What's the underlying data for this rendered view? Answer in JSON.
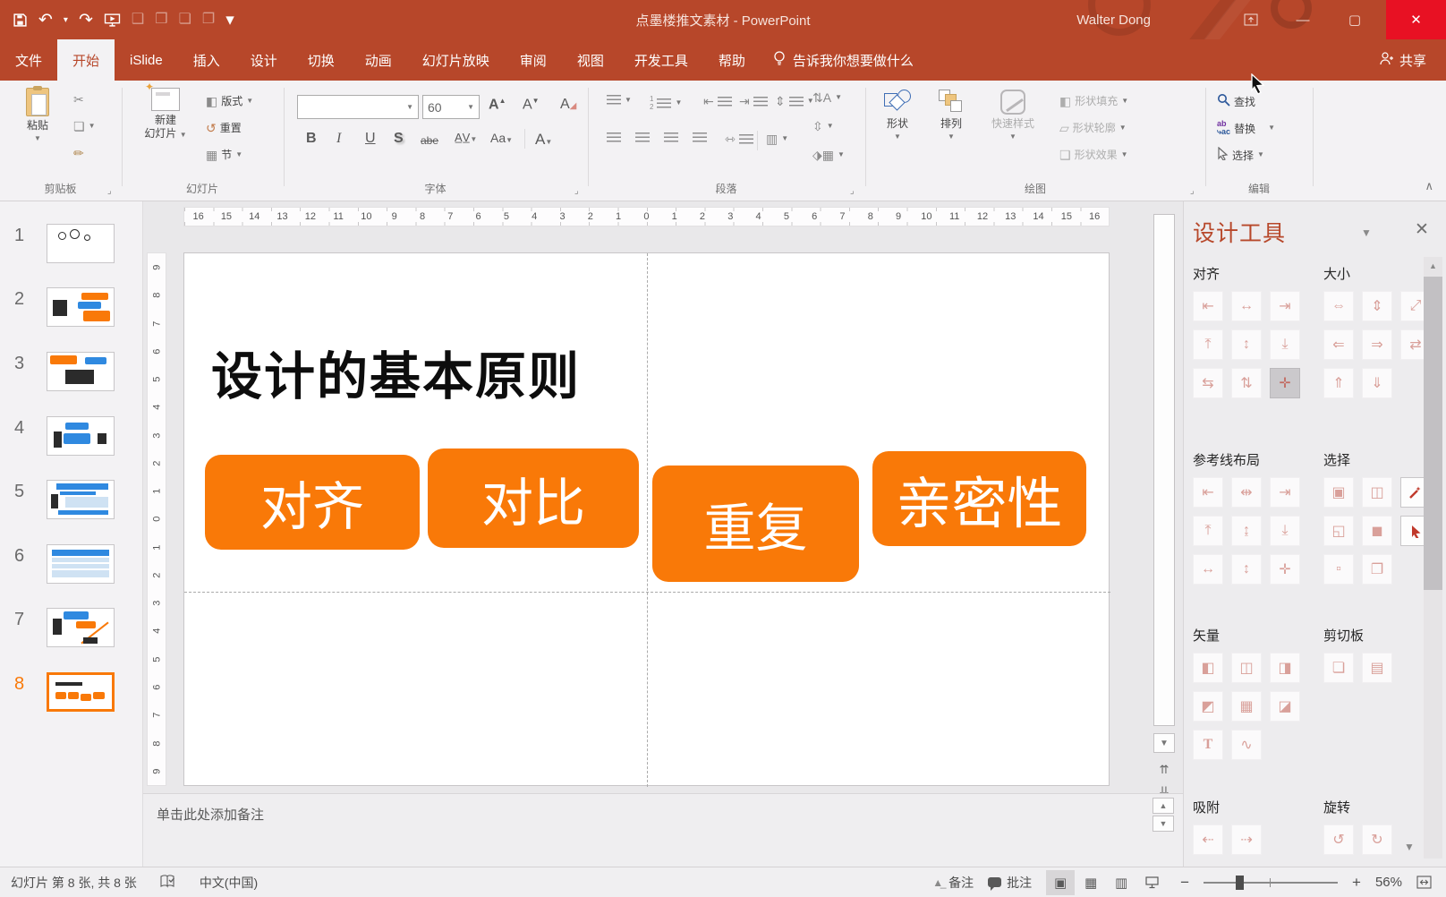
{
  "titlebar": {
    "title": "点墨楼推文素材  -  PowerPoint",
    "user": "Walter Dong",
    "qat": [
      {
        "name": "save"
      },
      {
        "name": "undo",
        "caret": true
      },
      {
        "name": "redo"
      },
      {
        "name": "slideshow-from-start"
      },
      {
        "name": "frame-tool",
        "disabled": true
      },
      {
        "name": "crop-tool",
        "disabled": true
      },
      {
        "name": "group-tool",
        "disabled": true
      },
      {
        "name": "ungroup-tool",
        "disabled": true
      },
      {
        "name": "customize-qat"
      }
    ]
  },
  "tabs": [
    {
      "label": "文件"
    },
    {
      "label": "开始",
      "active": true
    },
    {
      "label": "iSlide"
    },
    {
      "label": "插入"
    },
    {
      "label": "设计"
    },
    {
      "label": "切换"
    },
    {
      "label": "动画"
    },
    {
      "label": "幻灯片放映"
    },
    {
      "label": "审阅"
    },
    {
      "label": "视图"
    },
    {
      "label": "开发工具"
    },
    {
      "label": "帮助"
    }
  ],
  "tellme": "告诉我你想要做什么",
  "share": "共享",
  "ribbon": {
    "clipboard": {
      "paste": "粘贴",
      "group": "剪贴板"
    },
    "slides": {
      "new_slide_line1": "新建",
      "new_slide_line2": "幻灯片",
      "layout": "版式",
      "reset": "重置",
      "section": "节",
      "group": "幻灯片"
    },
    "font": {
      "size": "60",
      "group": "字体"
    },
    "paragraph": {
      "group": "段落"
    },
    "drawing": {
      "shapes": "形状",
      "arrange": "排列",
      "quick_styles": "快速样式",
      "shape_fill": "形状填充",
      "shape_outline": "形状轮廓",
      "shape_effects": "形状效果",
      "group": "绘图"
    },
    "editing": {
      "find": "查找",
      "replace": "替换",
      "select": "选择",
      "group": "编辑"
    }
  },
  "thumbnails": [
    {
      "num": "1"
    },
    {
      "num": "2"
    },
    {
      "num": "3"
    },
    {
      "num": "4"
    },
    {
      "num": "5"
    },
    {
      "num": "6"
    },
    {
      "num": "7"
    },
    {
      "num": "8",
      "selected": true
    }
  ],
  "rulers": {
    "h": [
      16,
      15,
      14,
      13,
      12,
      11,
      10,
      9,
      8,
      7,
      6,
      5,
      4,
      3,
      2,
      1,
      0,
      1,
      2,
      3,
      4,
      5,
      6,
      7,
      8,
      9,
      10,
      11,
      12,
      13,
      14,
      15,
      16
    ],
    "v": [
      9,
      8,
      7,
      6,
      5,
      4,
      3,
      2,
      1,
      0,
      1,
      2,
      3,
      4,
      5,
      6,
      7,
      8,
      9
    ]
  },
  "slide": {
    "title": "设计的基本原则",
    "buttons": [
      {
        "label": "对齐"
      },
      {
        "label": "对比"
      },
      {
        "label": "重复"
      },
      {
        "label": "亲密性"
      }
    ]
  },
  "notes_placeholder": "单击此处添加备注",
  "statusbar": {
    "slide_info": "幻灯片 第 8 张, 共 8 张",
    "language": "中文(中国)",
    "notes": "备注",
    "comments": "批注",
    "zoom_level": "56%"
  },
  "panel": {
    "title": "设计工具",
    "sections": [
      {
        "label": "对齐",
        "icons": [
          {
            "name": "align-left"
          },
          {
            "name": "align-center"
          },
          {
            "name": "align-right"
          },
          {
            "name": "align-top"
          },
          {
            "name": "align-middle"
          },
          {
            "name": "align-bottom"
          },
          {
            "name": "distribute-horizontal"
          },
          {
            "name": "distribute-vertical"
          },
          {
            "name": "center-on-slide",
            "selected": true
          }
        ]
      },
      {
        "label": "大小",
        "icons": [
          {
            "name": "same-width"
          },
          {
            "name": "same-height"
          },
          {
            "name": "same-size"
          },
          {
            "name": "stretch-left"
          },
          {
            "name": "stretch-right"
          },
          {
            "name": "swap-size"
          },
          {
            "name": "stretch-top"
          },
          {
            "name": "stretch-bottom"
          }
        ]
      },
      {
        "label": "参考线布局",
        "icons": [
          {
            "name": "guide-left"
          },
          {
            "name": "guide-center-horizontal"
          },
          {
            "name": "guide-right"
          },
          {
            "name": "guide-top"
          },
          {
            "name": "guide-center-vertical"
          },
          {
            "name": "guide-bottom"
          },
          {
            "name": "guide-margin-horizontal"
          },
          {
            "name": "guide-margin-vertical"
          },
          {
            "name": "guide-grid"
          }
        ]
      },
      {
        "label": "选择",
        "icons": [
          {
            "name": "select-same-format"
          },
          {
            "name": "select-same-size"
          },
          {
            "name": "magic-select",
            "accent": true
          },
          {
            "name": "select-smaller"
          },
          {
            "name": "select-larger"
          },
          {
            "name": "select-pointer",
            "accent": true
          },
          {
            "name": "select-small-objects"
          },
          {
            "name": "select-overlapped"
          }
        ]
      },
      {
        "label": "矢量",
        "icons": [
          {
            "name": "shape-union"
          },
          {
            "name": "shape-intersect"
          },
          {
            "name": "shape-subtract"
          },
          {
            "name": "shape-exclude"
          },
          {
            "name": "shape-combine"
          },
          {
            "name": "shape-crop"
          },
          {
            "name": "text-to-shape"
          },
          {
            "name": "edit-points"
          }
        ]
      },
      {
        "label": "剪切板",
        "icons": [
          {
            "name": "smart-copy"
          },
          {
            "name": "smart-paste"
          }
        ]
      },
      {
        "label": "吸附",
        "icons": [
          {
            "name": "snap-left"
          },
          {
            "name": "snap-right"
          }
        ]
      },
      {
        "label": "旋转",
        "icons": [
          {
            "name": "rotate-left"
          },
          {
            "name": "rotate-right"
          }
        ]
      }
    ]
  },
  "colors": {
    "titlebar_red": "#B7472A",
    "close_red": "#E81123",
    "accent_orange": "#F97908",
    "accent_red": "#C0392B",
    "icon_pink": "#D9A09A",
    "panel_title_red": "#B7472A",
    "find_blue": "#2B579A",
    "sketch_blue": "#2F89E0",
    "sketch_blue_light": "#CFE2F3",
    "sketch_dark": "#2B2B2B"
  }
}
